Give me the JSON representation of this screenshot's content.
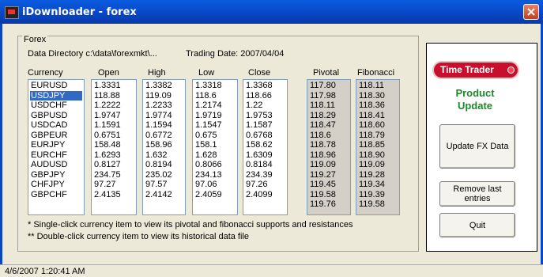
{
  "window": {
    "title": "iDownloader - forex"
  },
  "group": {
    "label": "Forex"
  },
  "info": {
    "data_directory": "Data Directory c:\\data\\forexmkt\\...",
    "trading_date": "Trading Date: 2007/04/04"
  },
  "columns": {
    "currency": "Currency",
    "open": "Open",
    "high": "High",
    "low": "Low",
    "close": "Close",
    "pivotal": "Pivotal",
    "fibonacci": "Fibonacci"
  },
  "currencies": [
    "EURUSD",
    "USDJPY",
    "USDCHF",
    "GBPUSD",
    "USDCAD",
    "GBPEUR",
    "EURJPY",
    "EURCHF",
    "AUDUSD",
    "GBPJPY",
    "CHFJPY",
    "GBPCHF"
  ],
  "selected_currency": "USDJPY",
  "open": [
    "1.3331",
    "118.88",
    "1.2222",
    "1.9747",
    "1.1591",
    "0.6751",
    "158.48",
    "1.6293",
    "0.8127",
    "234.75",
    "97.27",
    "2.4135"
  ],
  "high": [
    "1.3382",
    "119.09",
    "1.2233",
    "1.9774",
    "1.1594",
    "0.6772",
    "158.96",
    "1.632",
    "0.8194",
    "235.02",
    "97.57",
    "2.4142"
  ],
  "low": [
    "1.3318",
    "118.6",
    "1.2174",
    "1.9719",
    "1.1547",
    "0.675",
    "158.1",
    "1.628",
    "0.8066",
    "234.13",
    "97.06",
    "2.4059"
  ],
  "close": [
    "1.3368",
    "118.66",
    "1.22",
    "1.9753",
    "1.1587",
    "0.6768",
    "158.62",
    "1.6309",
    "0.8184",
    "234.39",
    "97.26",
    "2.4099"
  ],
  "pivotal": [
    "117.80",
    "117.98",
    "118.11",
    "118.29",
    "118.47",
    "118.6",
    "118.78",
    "118.96",
    "119.09",
    "119.27",
    "119.45",
    "119.58",
    "119.76"
  ],
  "fibonacci": [
    "118.11",
    "118.30",
    "118.36",
    "118.41",
    "118.60",
    "118.79",
    "118.85",
    "118.90",
    "119.09",
    "119.28",
    "119.34",
    "119.39",
    "119.58"
  ],
  "notes": {
    "single": "*   Single-click currency item to view its pivotal and fibonacci supports and resistances",
    "double": "**  Double-click currency item to view its historical data file"
  },
  "brand": {
    "logo": "Time Trader",
    "product_update_line1": "Product",
    "product_update_line2": "Update"
  },
  "buttons": {
    "update": "Update FX Data",
    "remove": "Remove last entries",
    "quit": "Quit"
  },
  "status": {
    "datetime": "4/6/2007 1:20:41 AM"
  },
  "colors": {
    "titlebar": "#0846c4",
    "selection": "#316ac5",
    "logo_red": "#c8102e",
    "update_green": "#1a8a2a"
  }
}
